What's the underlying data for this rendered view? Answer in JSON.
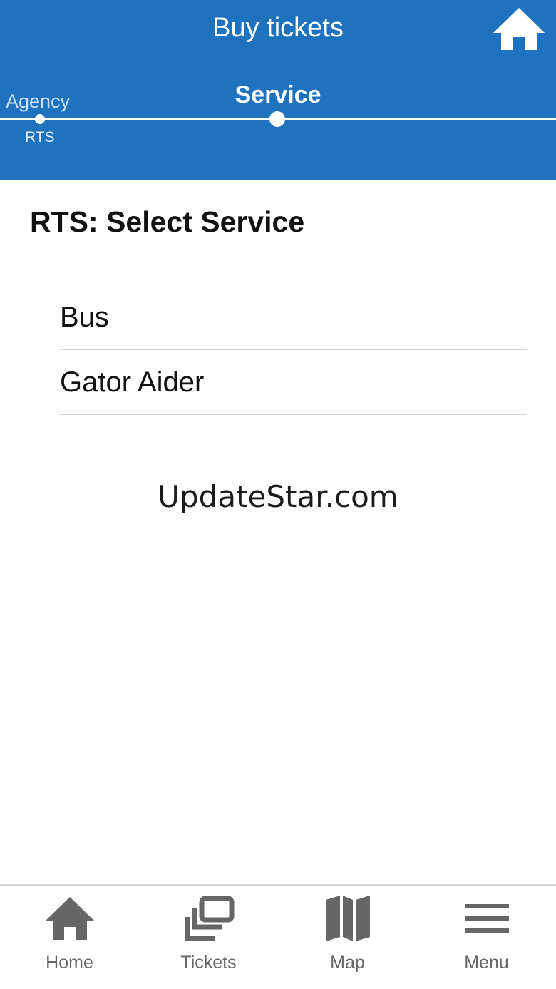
{
  "header": {
    "title": "Buy tickets",
    "home_icon": "home-icon",
    "background_color": "#1f72be"
  },
  "stepper": {
    "steps": [
      {
        "label": "Agency",
        "value": "RTS"
      },
      {
        "label": "Service"
      }
    ],
    "current_step": "Service"
  },
  "main": {
    "title": "RTS: Select Service",
    "services": [
      "Bus",
      "Gator Aider"
    ]
  },
  "watermark": "UpdateStar.com",
  "tabbar": {
    "tabs": [
      {
        "label": "Home",
        "icon": "home-icon"
      },
      {
        "label": "Tickets",
        "icon": "tickets-icon"
      },
      {
        "label": "Map",
        "icon": "map-icon"
      },
      {
        "label": "Menu",
        "icon": "menu-icon"
      }
    ]
  }
}
